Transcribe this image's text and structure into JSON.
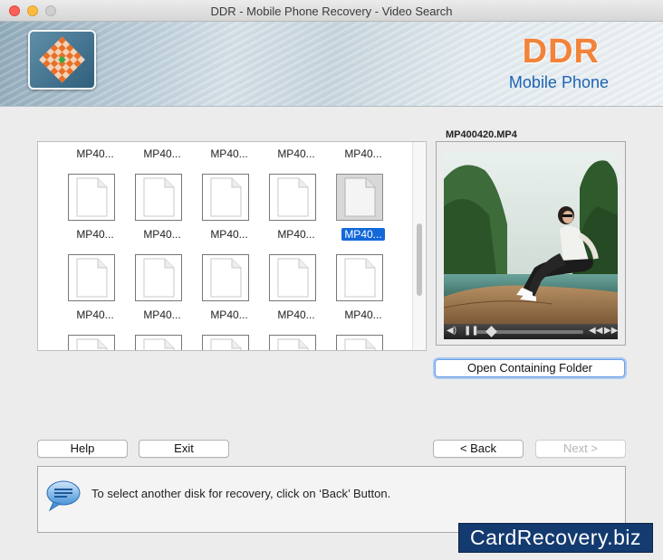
{
  "window": {
    "title": "DDR - Mobile Phone Recovery - Video Search"
  },
  "banner": {
    "brand": "DDR",
    "subbrand": "Mobile Phone"
  },
  "grid": {
    "rows": [
      [
        "MP40...",
        "MP40...",
        "MP40...",
        "MP40...",
        "MP40..."
      ],
      [
        "MP40...",
        "MP40...",
        "MP40...",
        "MP40...",
        "MP40..."
      ],
      [
        "MP40...",
        "MP40...",
        "MP40...",
        "MP40...",
        "MP40..."
      ]
    ],
    "selected": {
      "row": 1,
      "col": 4
    }
  },
  "preview": {
    "title": "MP400420.MP4",
    "open_folder_label": "Open Containing Folder"
  },
  "buttons": {
    "help": "Help",
    "exit": "Exit",
    "back": "< Back",
    "next": "Next >"
  },
  "message": {
    "text": "To select another disk for recovery, click on ‘Back’ Button."
  },
  "watermark": {
    "text": "CardRecovery.biz"
  },
  "colors": {
    "accent": "#1369d9",
    "brand_orange": "#f1833a",
    "subbrand_blue": "#1d64b3",
    "watermark_bg": "#143b70"
  }
}
